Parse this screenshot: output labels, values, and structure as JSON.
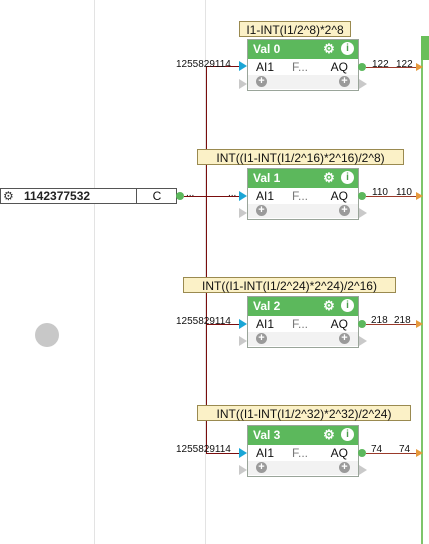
{
  "constant": {
    "value": "1142377532",
    "unit": "C",
    "out_label": "...",
    "icon": "gear-icon"
  },
  "blocks": [
    {
      "title": "Val 0",
      "formula": "I1-INT(I1/2^8)*2^8",
      "input": "AI1",
      "function": "F...",
      "output": "AQ",
      "in_value": "1255829114",
      "out_value_a": "122",
      "out_value_b": "122"
    },
    {
      "title": "Val 1",
      "formula": "INT((I1-INT(I1/2^16)*2^16)/2^8)",
      "input": "AI1",
      "function": "F...",
      "output": "AQ",
      "in_value": "...",
      "out_value_a": "110",
      "out_value_b": "110"
    },
    {
      "title": "Val 2",
      "formula": "INT((I1-INT(I1/2^24)*2^24)/2^16)",
      "input": "AI1",
      "function": "F...",
      "output": "AQ",
      "in_value": "1255829114",
      "out_value_a": "218",
      "out_value_b": "218"
    },
    {
      "title": "Val 3",
      "formula": "INT((I1-INT(I1/2^32)*2^32)/2^24)",
      "input": "AI1",
      "function": "F...",
      "output": "AQ",
      "in_value": "1255829114",
      "out_value_a": "74",
      "out_value_b": "74"
    }
  ],
  "icons": {
    "gear": "gear-icon",
    "info": "info-icon",
    "plus": "plus-icon"
  },
  "colors": {
    "block_header": "#5cb85c",
    "wire": "#7a0d0d",
    "input_port": "#1aa6d6",
    "output_arrow": "#e79a3c",
    "formula_bg": "#fbf1c7"
  }
}
